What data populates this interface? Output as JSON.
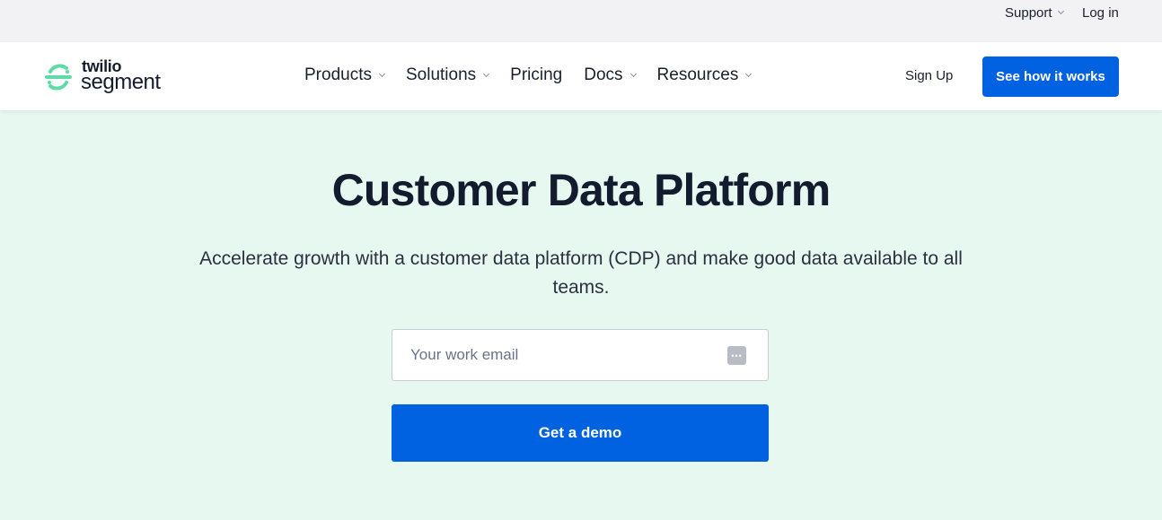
{
  "topbar": {
    "support_label": "Support",
    "login_label": "Log in"
  },
  "brand": {
    "line1": "twilio",
    "line2": "segment",
    "mark_color": "#5fdba7"
  },
  "nav": {
    "items": [
      {
        "label": "Products",
        "has_dropdown": true
      },
      {
        "label": "Solutions",
        "has_dropdown": true
      },
      {
        "label": "Pricing",
        "has_dropdown": false
      },
      {
        "label": "Docs",
        "has_dropdown": true
      },
      {
        "label": "Resources",
        "has_dropdown": true
      }
    ],
    "signup_label": "Sign Up",
    "cta_label": "See how it works"
  },
  "hero": {
    "title": "Customer Data Platform",
    "subtitle": "Accelerate growth with a customer data platform (CDP) and make good data available to all teams.",
    "email_placeholder": "Your work email",
    "email_value": "",
    "submit_label": "Get a demo"
  },
  "colors": {
    "accent": "#0062e0",
    "hero_bg": "#e7f8f0",
    "topbar_bg": "#f2f2f4"
  }
}
